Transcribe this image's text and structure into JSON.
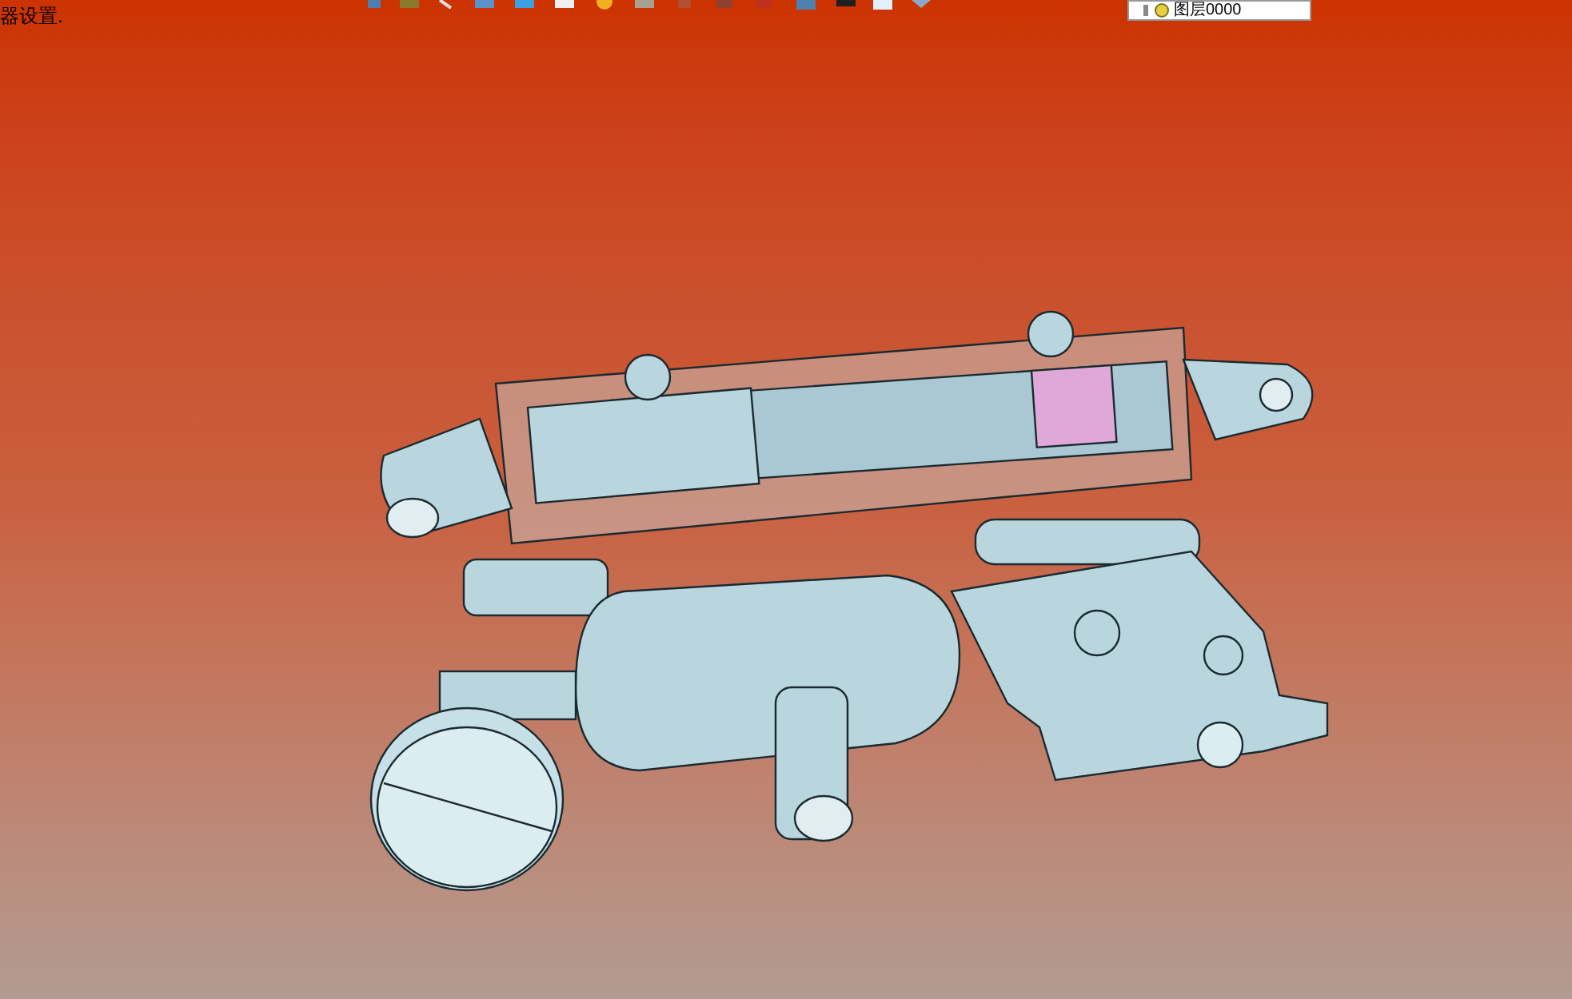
{
  "status_text": "器设置.",
  "layer_dropdown": {
    "value": "图层0000"
  }
}
